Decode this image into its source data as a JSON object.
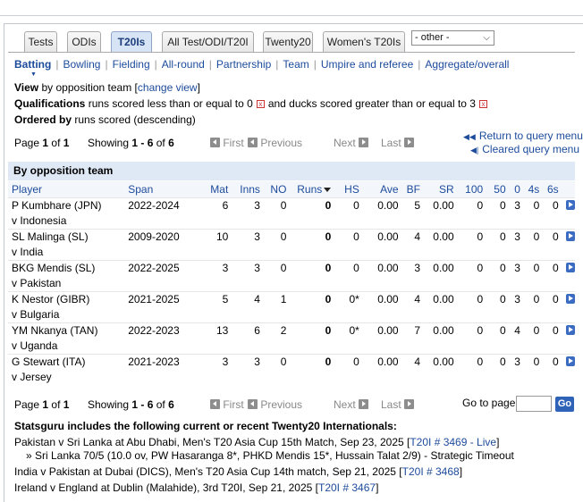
{
  "tabs": [
    {
      "label": "Tests"
    },
    {
      "label": "ODIs"
    },
    {
      "label": "T20Is"
    },
    {
      "label": "All Test/ODI/T20I"
    },
    {
      "label": "Twenty20"
    },
    {
      "label": "Women's T20Is"
    }
  ],
  "other_select": {
    "value": "- other -"
  },
  "subnav": [
    "Batting",
    "Bowling",
    "Fielding",
    "All-round",
    "Partnership",
    "Team",
    "Umpire and referee",
    "Aggregate/overall"
  ],
  "view": {
    "label": "View",
    "text": "by opposition team",
    "link": "change view"
  },
  "qualifications": {
    "label": "Qualifications",
    "text1": "runs scored less than or equal to 0",
    "text2": "and ducks scored greater than or equal to 3"
  },
  "ordered": {
    "label": "Ordered by",
    "text": "runs scored (descending)"
  },
  "pager": {
    "page_word": "Page",
    "page": "1",
    "of_word": "of",
    "total": "1",
    "showing_word": "Showing",
    "range": "1 - 6",
    "total_rows": "6",
    "first": "First",
    "previous": "Previous",
    "next": "Next",
    "last": "Last"
  },
  "right_links": {
    "return": "Return to query menu",
    "cleared": "Cleared query menu"
  },
  "section_title": "By opposition team",
  "columns": [
    "Player",
    "Span",
    "Mat",
    "Inns",
    "NO",
    "Runs",
    "HS",
    "Ave",
    "BF",
    "SR",
    "100",
    "50",
    "0",
    "4s",
    "6s"
  ],
  "rows": [
    {
      "player": "P Kumbhare (JPN)",
      "span": "2022-2024",
      "mat": "6",
      "inns": "3",
      "no": "0",
      "runs": "0",
      "hs": "0",
      "ave": "0.00",
      "bf": "5",
      "sr": "0.00",
      "h": "0",
      "f": "0",
      "d": "3",
      "fours": "0",
      "sixes": "0",
      "opp": "v Indonesia"
    },
    {
      "player": "SL Malinga (SL)",
      "span": "2009-2020",
      "mat": "10",
      "inns": "3",
      "no": "0",
      "runs": "0",
      "hs": "0",
      "ave": "0.00",
      "bf": "4",
      "sr": "0.00",
      "h": "0",
      "f": "0",
      "d": "3",
      "fours": "0",
      "sixes": "0",
      "opp": "v India"
    },
    {
      "player": "BKG Mendis (SL)",
      "span": "2022-2025",
      "mat": "3",
      "inns": "3",
      "no": "0",
      "runs": "0",
      "hs": "0",
      "ave": "0.00",
      "bf": "3",
      "sr": "0.00",
      "h": "0",
      "f": "0",
      "d": "3",
      "fours": "0",
      "sixes": "0",
      "opp": "v Pakistan"
    },
    {
      "player": "K Nestor (GIBR)",
      "span": "2021-2025",
      "mat": "5",
      "inns": "4",
      "no": "1",
      "runs": "0",
      "hs": "0*",
      "ave": "0.00",
      "bf": "4",
      "sr": "0.00",
      "h": "0",
      "f": "0",
      "d": "3",
      "fours": "0",
      "sixes": "0",
      "opp": "v Bulgaria"
    },
    {
      "player": "YM Nkanya (TAN)",
      "span": "2022-2023",
      "mat": "13",
      "inns": "6",
      "no": "2",
      "runs": "0",
      "hs": "0*",
      "ave": "0.00",
      "bf": "7",
      "sr": "0.00",
      "h": "0",
      "f": "0",
      "d": "4",
      "fours": "0",
      "sixes": "0",
      "opp": "v Uganda"
    },
    {
      "player": "G Stewart (ITA)",
      "span": "2021-2023",
      "mat": "3",
      "inns": "3",
      "no": "0",
      "runs": "0",
      "hs": "0",
      "ave": "0.00",
      "bf": "4",
      "sr": "0.00",
      "h": "0",
      "f": "0",
      "d": "3",
      "fours": "0",
      "sixes": "0",
      "opp": "v Jersey"
    }
  ],
  "goto": {
    "label": "Go to page",
    "button": "Go"
  },
  "footer": {
    "title": "Statsguru includes the following current or recent Twenty20 Internationals:",
    "items": [
      {
        "text": "Pakistan v Sri Lanka at Abu Dhabi, Men's T20 Asia Cup 15th Match, Sep 23, 2025",
        "link": "T20I # 3469 - Live"
      },
      {
        "text": "» Sri Lanka 70/5 (10.0 ov, PW Hasaranga 8*, PHKD Mendis 15*, Hussain Talat 2/9) - Strategic Timeout"
      },
      {
        "text": "India v Pakistan at Dubai (DICS), Men's T20 Asia Cup 14th match, Sep 21, 2025",
        "link": "T20I # 3468"
      },
      {
        "text": "Ireland v England at Dublin (Malahide), 3rd T20I, Sep 21, 2025",
        "link": "T20I # 3467"
      }
    ]
  }
}
